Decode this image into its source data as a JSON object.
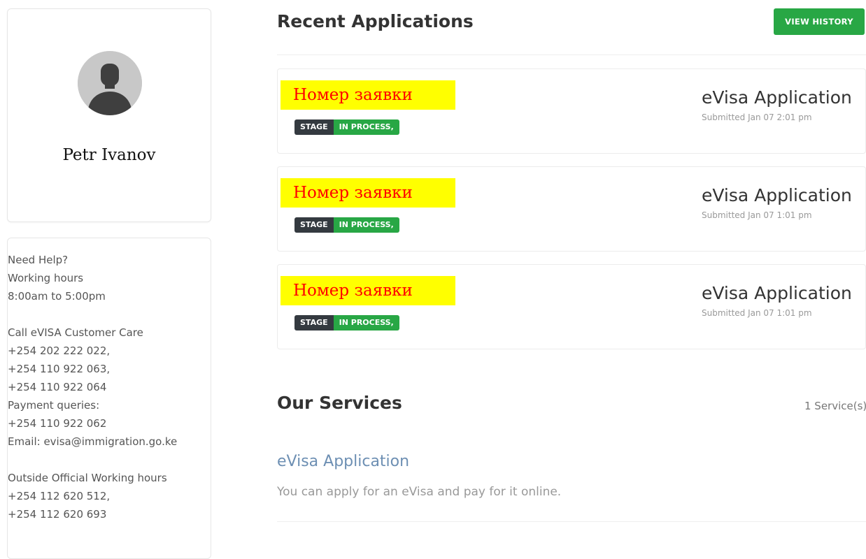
{
  "profile": {
    "name": "Petr Ivanov"
  },
  "help": {
    "lines_group1": [
      "Need Help?",
      "Working hours",
      "8:00am to 5:00pm"
    ],
    "lines_group2": [
      "Call eVISA Customer Care",
      "+254 202 222 022,",
      "+254 110 922 063,",
      "+254 110 922 064",
      "Payment queries:",
      "+254 110 922 062",
      "Email: evisa@immigration.go.ke"
    ],
    "lines_group3": [
      "Outside Official Working hours",
      "+254 112 620 512,",
      "+254 112 620 693"
    ]
  },
  "recent": {
    "title": "Recent Applications",
    "view_history_label": "VIEW HISTORY",
    "applications": [
      {
        "number_label": "Номер заявки",
        "stage_label": "STAGE",
        "stage_value": "IN PROCESS,",
        "title": "eVisa Application",
        "submitted": "Submitted Jan 07 2:01 pm"
      },
      {
        "number_label": "Номер заявки",
        "stage_label": "STAGE",
        "stage_value": "IN PROCESS,",
        "title": "eVisa Application",
        "submitted": "Submitted Jan 07 1:01 pm"
      },
      {
        "number_label": "Номер заявки",
        "stage_label": "STAGE",
        "stage_value": "IN PROCESS,",
        "title": "eVisa Application",
        "submitted": "Submitted Jan 07 1:01 pm"
      }
    ]
  },
  "services": {
    "title": "Our Services",
    "count": "1 Service(s)",
    "items": [
      {
        "name": "eVisa Application",
        "description": "You can apply for an eVisa and pay for it online."
      }
    ]
  },
  "colors": {
    "accent_green": "#28a745",
    "highlight_yellow": "#ffff00",
    "highlight_text_red": "#ff0000",
    "service_link_blue": "#6d8fb3"
  }
}
